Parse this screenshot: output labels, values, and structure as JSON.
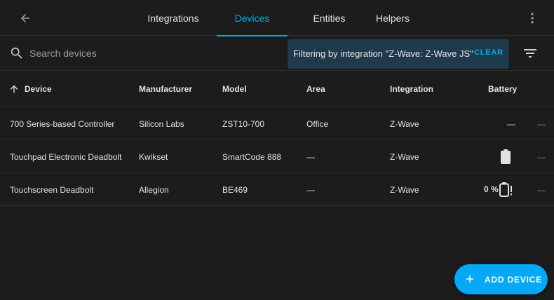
{
  "colors": {
    "background": "#1c1c1c",
    "accent": "#03a9f4",
    "text": "#e1e1e1",
    "divider": "#2f2f2f",
    "filter_chip_bg": "#1f3a4a"
  },
  "topbar": {
    "back_icon": "arrow-left-icon",
    "tabs": [
      {
        "label": "Integrations",
        "active": false
      },
      {
        "label": "Devices",
        "active": true
      },
      {
        "label": "Entities",
        "active": false
      },
      {
        "label": "Helpers",
        "active": false
      }
    ],
    "menu_icon": "dots-vertical-icon"
  },
  "search": {
    "placeholder": "Search devices",
    "value": "",
    "icon": "search-icon"
  },
  "filter": {
    "text": "Filtering by integration \"Z-Wave: Z-Wave JS\"",
    "clear_label": "CLEAR",
    "filter_icon": "filter-variant-icon"
  },
  "table": {
    "columns": [
      "Device",
      "Manufacturer",
      "Model",
      "Area",
      "Integration",
      "Battery"
    ],
    "sort_icon": "arrow-up-icon",
    "rows": [
      {
        "device": "700 Series-based Controller",
        "manufacturer": "Silicon Labs",
        "model": "ZST10-700",
        "area": "Office",
        "integration": "Z-Wave",
        "battery": "—",
        "extra": "—"
      },
      {
        "device": "Touchpad Electronic Deadbolt",
        "manufacturer": "Kwikset",
        "model": "SmartCode 888",
        "area": "—",
        "integration": "Z-Wave",
        "battery_icon": "battery-full-icon",
        "extra": "—"
      },
      {
        "device": "Touchscreen Deadbolt",
        "manufacturer": "Allegion",
        "model": "BE469",
        "area": "—",
        "integration": "Z-Wave",
        "battery": "0 %",
        "battery_icon": "battery-alert-icon",
        "extra": "—"
      }
    ]
  },
  "fab": {
    "label": "ADD DEVICE",
    "icon": "plus-icon"
  }
}
